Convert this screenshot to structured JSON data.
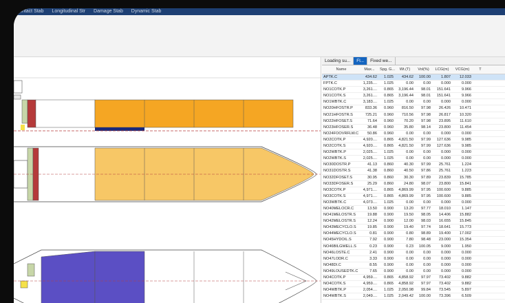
{
  "menubar": {
    "items": [
      "Intact Stab",
      "Longitudinal Str",
      "Damage Stab",
      "Dynamic Stab"
    ]
  },
  "tabs": [
    {
      "label": "Loading su...",
      "active": false
    },
    {
      "label": "Fl...",
      "active": true
    },
    {
      "label": "Fixed we...",
      "active": false
    }
  ],
  "columns": [
    "Name",
    "Max...",
    "Spg. G...",
    "Wt.(T)",
    "Vol(%)",
    "LCG(m)",
    "VCG(m)",
    "T"
  ],
  "rows": [
    [
      "APTK.C",
      "434.62",
      "1.025",
      "434.62",
      "100.00",
      "1.807",
      "12.033"
    ],
    [
      "FPTK.C",
      "1,235....",
      "1.025",
      "0.00",
      "0.00",
      "0.000",
      "0.000"
    ],
    [
      "NO1COTK.P",
      "3,261....",
      "0.865",
      "3,196.44",
      "98.01",
      "151.641",
      "9.966"
    ],
    [
      "NO1COTK.S",
      "3,261....",
      "0.865",
      "3,196.44",
      "98.01",
      "151.641",
      "9.966"
    ],
    [
      "NO1WBTK.C",
      "3,183....",
      "1.025",
      "0.00",
      "0.00",
      "0.000",
      "0.000"
    ],
    [
      "NO20HFOSTR.P",
      "833.36",
      "0.960",
      "816.50",
      "97.98",
      "26.426",
      "10.471"
    ],
    [
      "NO21HFOSTR.S",
      "725.21",
      "0.960",
      "710.56",
      "97.98",
      "26.817",
      "10.320"
    ],
    [
      "NO22HFOSET.S",
      "71.64",
      "0.960",
      "70.20",
      "97.98",
      "23.895",
      "11.610"
    ],
    [
      "NO23HFOSER.S",
      "36.48",
      "0.960",
      "35.80",
      "98.14",
      "23.800",
      "11.454"
    ],
    [
      "NO24FOOVRFLW.C",
      "50.86",
      "0.960",
      "0.00",
      "0.00",
      "0.000",
      "0.000"
    ],
    [
      "NO2COTK.P",
      "4,920....",
      "0.865",
      "4,821.50",
      "97.99",
      "127.636",
      "9.985"
    ],
    [
      "NO2COTK.S",
      "4,920....",
      "0.865",
      "4,821.50",
      "97.99",
      "127.636",
      "9.985"
    ],
    [
      "NO2WBTK.P",
      "2,025....",
      "1.025",
      "0.00",
      "0.00",
      "0.000",
      "0.000"
    ],
    [
      "NO2WBTK.S",
      "2,025....",
      "1.025",
      "0.00",
      "0.00",
      "0.000",
      "0.000"
    ],
    [
      "NO30DOSTR.P",
      "41.13",
      "0.860",
      "40.30",
      "97.99",
      "25.761",
      "1.224"
    ],
    [
      "NO31DOSTR.S",
      "41.38",
      "0.860",
      "40.50",
      "97.86",
      "25.761",
      "1.223"
    ],
    [
      "NO32DFOSET.S",
      "30.95",
      "0.860",
      "30.30",
      "97.89",
      "23.839",
      "15.785"
    ],
    [
      "NO33DFOSER.S",
      "25.29",
      "0.860",
      "24.80",
      "98.07",
      "23.800",
      "15.841"
    ],
    [
      "NO3COTK.P",
      "4,971....",
      "0.865",
      "4,869.99",
      "97.95",
      "100.600",
      "9.885"
    ],
    [
      "NO3COTK.S",
      "4,971....",
      "0.865",
      "4,869.99",
      "97.95",
      "100.600",
      "9.885"
    ],
    [
      "NO3WBTK.C",
      "4,073....",
      "1.025",
      "0.00",
      "0.00",
      "0.000",
      "0.000"
    ],
    [
      "NO40MELOCR.C",
      "13.50",
      "0.900",
      "13.20",
      "97.77",
      "18.010",
      "1.147"
    ],
    [
      "NO41MELOSTR.S",
      "19.88",
      "0.900",
      "19.50",
      "98.05",
      "14.406",
      "15.882"
    ],
    [
      "NO42MELOSTR.S",
      "12.24",
      "0.900",
      "12.00",
      "98.03",
      "16.655",
      "15.845"
    ],
    [
      "NO43MECYCLO.S",
      "19.85",
      "0.900",
      "19.40",
      "97.74",
      "18.641",
      "15.773"
    ],
    [
      "NO44MECYCLO.S",
      "0.81",
      "0.900",
      "0.80",
      "98.89",
      "19.400",
      "17.002"
    ],
    [
      "NO45HYDOIL.S",
      "7.92",
      "0.900",
      "7.80",
      "98.48",
      "23.000",
      "15.354"
    ],
    [
      "NO46BILGWELL.S",
      "0.23",
      "0.900",
      "0.23",
      "100.05",
      "9.000",
      "1.950"
    ],
    [
      "NO46LOSTE.C",
      "2.41",
      "0.900",
      "0.00",
      "0.00",
      "0.000",
      "0.000"
    ],
    [
      "NO47LODR.C",
      "3.33",
      "0.900",
      "0.00",
      "0.00",
      "0.000",
      "0.000"
    ],
    [
      "NO48DI.C",
      "8.55",
      "0.900",
      "0.00",
      "0.00",
      "0.000",
      "0.000"
    ],
    [
      "NO49LOUSEDTK.C",
      "7.65",
      "0.900",
      "0.00",
      "0.00",
      "0.000",
      "0.000"
    ],
    [
      "NO4COTK.P",
      "4,959....",
      "0.865",
      "4,858.92",
      "97.97",
      "73.402",
      "9.882"
    ],
    [
      "NO4COTK.S",
      "4,959....",
      "0.865",
      "4,858.92",
      "97.97",
      "73.402",
      "9.882"
    ],
    [
      "NO4WBTK.P",
      "2,054....",
      "1.025",
      "2,050.98",
      "99.84",
      "73.545",
      "5.897"
    ],
    [
      "NO4WBTK.S",
      "2,049....",
      "1.025",
      "2,049.42",
      "100.00",
      "73.396",
      "6.509"
    ]
  ],
  "colors": {
    "cargo": "#f5a623",
    "cargo_light": "#f7c766",
    "ballast": "#5b4fc4",
    "hfo": "#b53a3a",
    "menubar": "#1d3f73",
    "tab_active": "#1565c0"
  }
}
